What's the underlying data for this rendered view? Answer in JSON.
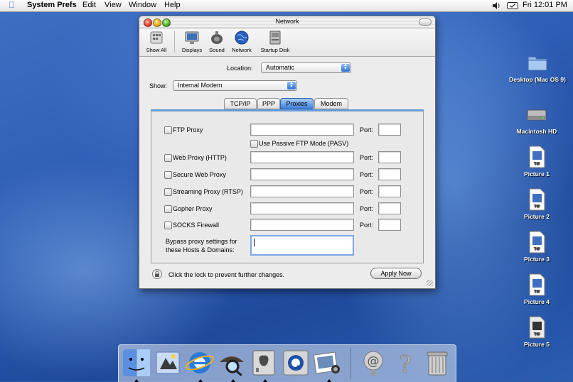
{
  "menubar": {
    "app_name": "System Prefs",
    "menus": [
      "Edit",
      "View",
      "Window",
      "Help"
    ],
    "clock": "Fri 12:01 PM"
  },
  "window": {
    "title": "Network",
    "toolbar": {
      "show_all": "Show All",
      "items": [
        "Displays",
        "Sound",
        "Network",
        "Startup Disk"
      ]
    },
    "location": {
      "label": "Location:",
      "value": "Automatic"
    },
    "show": {
      "label": "Show:",
      "value": "Internal Modem"
    },
    "tabs": [
      "TCP/IP",
      "PPP",
      "Proxies",
      "Modem"
    ],
    "active_tab": "Proxies",
    "proxies": [
      {
        "label": "FTP Proxy",
        "checked": false,
        "server": "",
        "port": ""
      },
      {
        "label": "Web Proxy (HTTP)",
        "checked": false,
        "server": "",
        "port": ""
      },
      {
        "label": "Secure Web Proxy",
        "checked": false,
        "server": "",
        "port": ""
      },
      {
        "label": "Streaming Proxy (RTSP)",
        "checked": false,
        "server": "",
        "port": ""
      },
      {
        "label": "Gopher Proxy",
        "checked": false,
        "server": "",
        "port": ""
      },
      {
        "label": "SOCKS Firewall",
        "checked": false,
        "server": "",
        "port": ""
      }
    ],
    "port_label": "Port:",
    "passive_ftp": {
      "label": "Use Passive FTP Mode (PASV)",
      "checked": false
    },
    "bypass": {
      "label_line1": "Bypass proxy settings for",
      "label_line2": "these Hosts & Domains:",
      "value": ""
    },
    "lock_text": "Click the lock to prevent further changes.",
    "apply_label": "Apply Now"
  },
  "desktop_icons": [
    {
      "label": "Desktop (Mac OS 9)",
      "icon": "folder-icon"
    },
    {
      "label": "Macintosh HD",
      "icon": "hard-disk-icon"
    },
    {
      "label": "Picture 1",
      "icon": "tiff-file-icon"
    },
    {
      "label": "Picture 2",
      "icon": "tiff-file-icon"
    },
    {
      "label": "Picture 3",
      "icon": "tiff-file-icon"
    },
    {
      "label": "Picture 4",
      "icon": "tiff-file-icon"
    },
    {
      "label": "Picture 5",
      "icon": "tiff-file-icon"
    }
  ],
  "file_badge": "TIF",
  "dock": [
    "finder-icon",
    "mail-icon",
    "internet-explorer-icon",
    "sherlock-icon",
    "system-preferences-icon",
    "quicktime-icon",
    "iphoto-icon",
    "mail-at-icon",
    "help-icon",
    "trash-icon"
  ],
  "colors": {
    "accent": "#3d7fdb",
    "desktop": "#2d5db4"
  }
}
